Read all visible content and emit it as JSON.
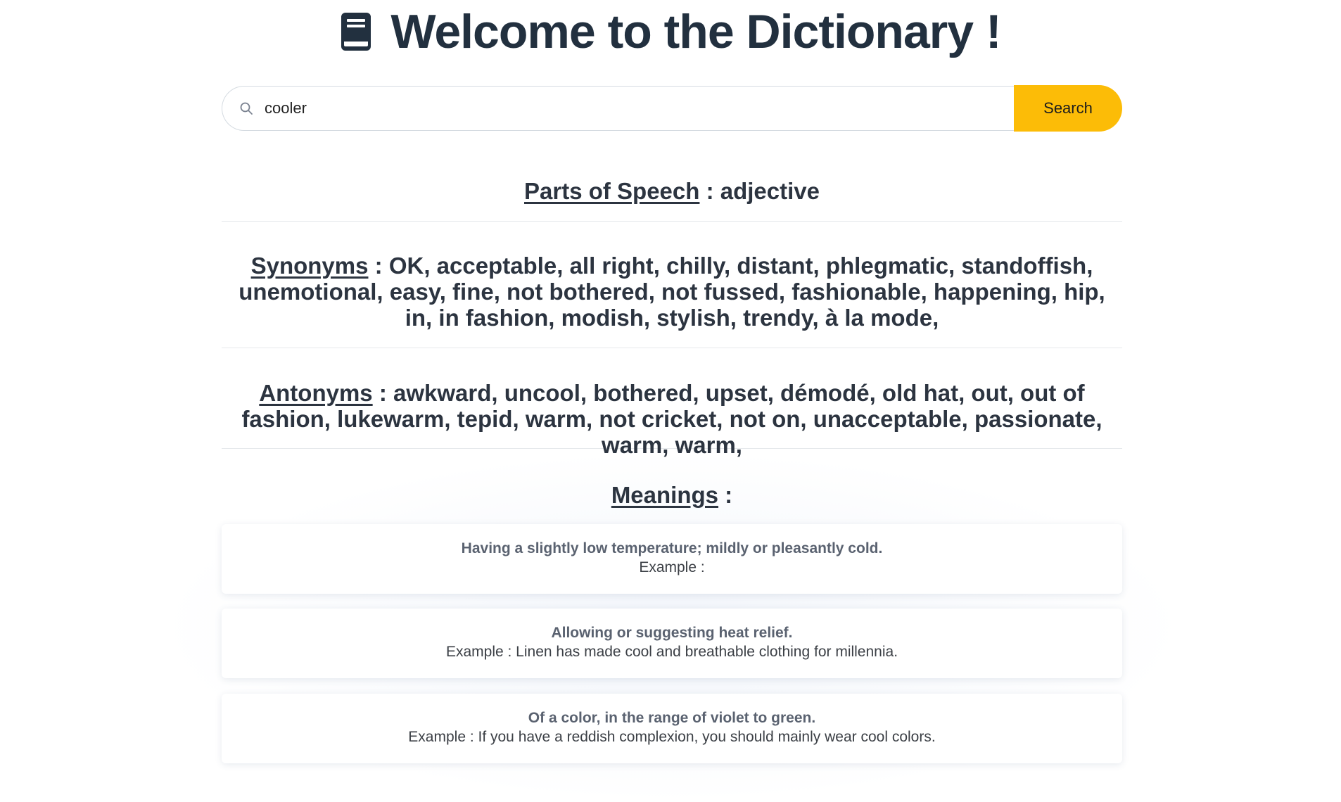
{
  "header": {
    "title": "Welcome to the Dictionary !",
    "icon": "book-icon"
  },
  "search": {
    "value": "cooler",
    "placeholder": "",
    "button_label": "Search",
    "button_color": "#fcbc07"
  },
  "parts_of_speech": {
    "label": "Parts of Speech",
    "separator": " : ",
    "value": "adjective"
  },
  "synonyms": {
    "label": "Synonyms",
    "separator": " : ",
    "value": "OK, acceptable, all right, chilly, distant, phlegmatic, standoffish, unemotional, easy, fine, not bothered, not fussed, fashionable, happening, hip, in, in fashion, modish, stylish, trendy, à la mode,"
  },
  "antonyms": {
    "label": "Antonyms",
    "separator": " : ",
    "value": "awkward, uncool, bothered, upset, démodé, old hat, out, out of fashion, lukewarm, tepid, warm, not cricket, not on, unacceptable, passionate, warm, warm,"
  },
  "meanings": {
    "label": "Meanings",
    "separator": " :",
    "items": [
      {
        "definition": "Having a slightly low temperature; mildly or pleasantly cold.",
        "example": "Example :"
      },
      {
        "definition": "Allowing or suggesting heat relief.",
        "example": "Example : Linen has made cool and breathable clothing for millennia."
      },
      {
        "definition": "Of a color, in the range of violet to green.",
        "example": "Example : If you have a reddish complexion, you should mainly wear cool colors."
      }
    ]
  }
}
